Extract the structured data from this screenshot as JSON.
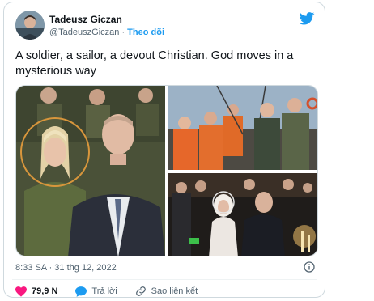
{
  "author": {
    "name": "Tadeusz Giczan",
    "handle": "@TadeuszGiczan",
    "separator": "·",
    "follow_label": "Theo dõi"
  },
  "tweet": {
    "text": "A soldier, a sailor, a devout Christian. God moves in a mysterious way",
    "timestamp": "8:33 SA · 31 thg 12, 2022"
  },
  "actions": {
    "likes": "79,9 N",
    "reply_label": "Trả lời",
    "copy_link_label": "Sao liên kết"
  },
  "icons": [
    "twitter-bird-icon",
    "info-icon",
    "heart-icon",
    "reply-bubble-icon",
    "link-icon"
  ],
  "colors": {
    "accent": "#1d9bf0",
    "like": "#f91880",
    "highlight_circle": "#d8963c",
    "muted": "#536471"
  }
}
